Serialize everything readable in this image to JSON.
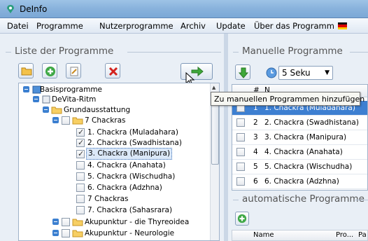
{
  "window": {
    "title": "DeInfo"
  },
  "menu": {
    "items": [
      "Datei",
      "Programme",
      "Nutzerprogramme",
      "Archiv",
      "Update",
      "Über das Programm"
    ]
  },
  "left": {
    "group_title": "Liste der Programme",
    "tree": {
      "root": "Basisprogramme",
      "device": "DeVita-Ritm",
      "group": "Grundausstattung",
      "folder": "7 Chackras",
      "items": [
        "1. Chackra (Muladahara)",
        "2. Chackra (Swadhistana)",
        "3. Chackra (Manipura)",
        "4. Chackra (Anahata)",
        "5. Chackra (Wischudha)",
        "6. Chackra (Adzhna)",
        "7 Chackras",
        "7. Chackra (Sahasrara)"
      ],
      "more_folders": [
        "Akupunktur - die Thyreoidea",
        "Akupunktur - Neurologie"
      ]
    }
  },
  "tooltip": "Zu manuellen Programmen hinzufügen",
  "right": {
    "manual_title": "Manuelle Programme",
    "interval": "5 Seku",
    "header_num": "#",
    "header_name": "N",
    "rows": [
      {
        "num": "1",
        "name": "1. Chackra (Muladahara)"
      },
      {
        "num": "2",
        "name": "2. Chackra (Swadhistana)"
      },
      {
        "num": "3",
        "name": "3. Chackra (Manipura)"
      },
      {
        "num": "4",
        "name": "4. Chackra (Anahata)"
      },
      {
        "num": "5",
        "name": "5. Chackra (Wischudha)"
      },
      {
        "num": "6",
        "name": "6. Chackra (Adzhna)"
      }
    ],
    "auto_title": "automatische Programme",
    "auto_cols": [
      "Name",
      "Pro...",
      "Pa"
    ]
  }
}
